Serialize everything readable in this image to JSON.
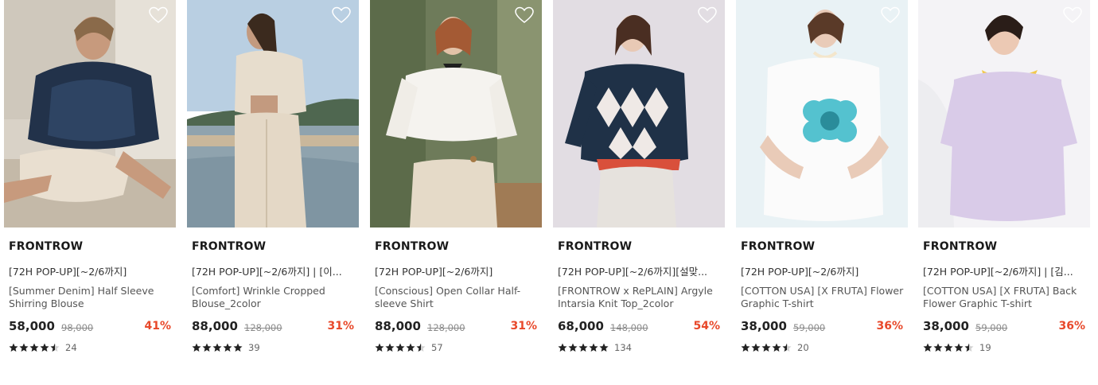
{
  "products": [
    {
      "brand": "FRONTROW",
      "promo": "[72H POP-UP][~2/6까지]",
      "name": "[Summer Denim] Half Sleeve Shirring Blouse",
      "price": "58,000",
      "original_price": "98,000",
      "discount": "41%",
      "rating": 4.5,
      "review_count": "24",
      "image": "model-navy-blouse",
      "icon": "heart-icon"
    },
    {
      "brand": "FRONTROW",
      "promo": "[72H POP-UP][~2/6까지] | [이...",
      "name": "[Comfort] Wrinkle Cropped Blouse_2color",
      "price": "88,000",
      "original_price": "128,000",
      "discount": "31%",
      "rating": 5,
      "review_count": "39",
      "image": "model-beige-blouse-seaside",
      "icon": "heart-icon"
    },
    {
      "brand": "FRONTROW",
      "promo": "[72H POP-UP][~2/6까지]",
      "name": "[Conscious] Open Collar Half-sleeve Shirt",
      "price": "88,000",
      "original_price": "128,000",
      "discount": "31%",
      "rating": 4.5,
      "review_count": "57",
      "image": "model-white-shirt",
      "icon": "heart-icon"
    },
    {
      "brand": "FRONTROW",
      "promo": "[72H POP-UP][~2/6까지][설맞...",
      "name": "[FRONTROW x RePLAIN] Argyle Intarsia Knit Top_2color",
      "price": "68,000",
      "original_price": "148,000",
      "discount": "54%",
      "rating": 5,
      "review_count": "134",
      "image": "model-argyle-knit",
      "icon": "heart-icon"
    },
    {
      "brand": "FRONTROW",
      "promo": "[72H POP-UP][~2/6까지]",
      "name": "[COTTON USA] [X FRUTA] Flower Graphic T-shirt",
      "price": "38,000",
      "original_price": "59,000",
      "discount": "36%",
      "rating": 4.5,
      "review_count": "20",
      "image": "model-white-flower-tee",
      "icon": "heart-icon"
    },
    {
      "brand": "FRONTROW",
      "promo": "[72H POP-UP][~2/6까지] | [김...",
      "name": "[COTTON USA] [X FRUTA] Back Flower Graphic T-shirt",
      "price": "38,000",
      "original_price": "59,000",
      "discount": "36%",
      "rating": 4.5,
      "review_count": "19",
      "image": "model-lilac-tee",
      "icon": "heart-icon"
    }
  ],
  "colors": {
    "discount": "#e8482a",
    "star": "#222222",
    "heart_outline": "#ffffff"
  }
}
